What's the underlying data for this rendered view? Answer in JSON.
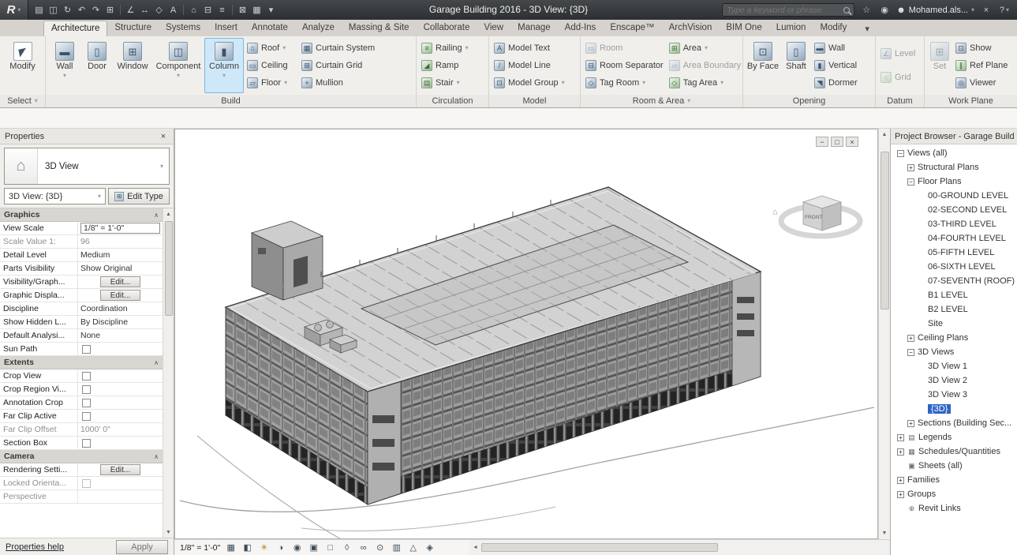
{
  "colors": {
    "titlebar-bg": "#2c2f31",
    "titlebar-top": "#45494c",
    "tabs-bg": "#d6d3ce",
    "ribbon-bg": "#f0efec",
    "column-highlight": "#cfe8f9",
    "selection": "#2d64c8"
  },
  "icons": {
    "caret": "▾",
    "open": "▤",
    "save": "◫",
    "sync": "↻",
    "undo": "↶",
    "redo": "↷",
    "print": "⊞",
    "measure": "∠",
    "dimension": "↔",
    "tag": "◇",
    "text": "A",
    "view3d": "⌂",
    "section": "⊟",
    "thin_lines": "≡",
    "close_windows": "⊠",
    "switch_windows": "▦",
    "favorites": "☆",
    "comm": "◉",
    "user": "☻",
    "exchange": "×",
    "help": "?",
    "min": "−",
    "restore": "□",
    "close": "×",
    "plus": "+",
    "minus": "−",
    "chevron": "∧",
    "scroll_left": "◄",
    "scroll_up": "▲",
    "scroll_down": "▼",
    "home": "⌂",
    "sun": "☀",
    "modify": "◤",
    "wall": "▬",
    "door": "▯",
    "window": "⊞",
    "component": "◫",
    "column": "▮",
    "roof": "⌂",
    "ceiling": "▭",
    "floor": "▱",
    "curtain_system": "▦",
    "curtain_grid": "⊞",
    "mullion": "+",
    "railing": "≡",
    "ramp": "◢",
    "stair": "▤",
    "model_text": "A",
    "model_line": "/",
    "model_group": "⊡",
    "room": "▭",
    "room_separator": "⊟",
    "tag_room": "◇",
    "area": "⊞",
    "area_boundary": "▱",
    "tag_area": "◇",
    "by_face": "⊡",
    "shaft": "▯",
    "opening_wall": "▬",
    "vertical": "▮",
    "dormer": "◥",
    "level": "∠",
    "grid": "○",
    "set": "⊞",
    "show": "⊡",
    "ref_plane": "∥",
    "viewer": "◎",
    "edit_type": "⊞",
    "detail_level": "▦",
    "visual_style": "◧",
    "shadows": "◑",
    "render": "◉",
    "crop": "▣",
    "crop_region": "□",
    "lock": "◊",
    "hide_isolate": "∞",
    "reveal": "⊙",
    "temp_props": "▥",
    "analytical": "△",
    "displacement": "◈",
    "legends": "▤",
    "schedules": "▦",
    "sheets": "▣",
    "link": "⊕"
  },
  "titlebar": {
    "app": "R",
    "title": "Garage Building 2016 - 3D View: {3D}",
    "search_placeholder": "Type a keyword or phrase",
    "user": "Mohamed.als..."
  },
  "tabs": [
    "Architecture",
    "Structure",
    "Systems",
    "Insert",
    "Annotate",
    "Analyze",
    "Massing & Site",
    "Collaborate",
    "View",
    "Manage",
    "Add-Ins",
    "Enscape™",
    "ArchVision",
    "BIM One",
    "Lumion",
    "Modify"
  ],
  "ribbon": {
    "select": {
      "label": "Select",
      "modify": "Modify"
    },
    "build": {
      "label": "Build",
      "wall": "Wall",
      "door": "Door",
      "window": "Window",
      "component": "Component",
      "column": "Column",
      "roof": "Roof",
      "ceiling": "Ceiling",
      "floor": "Floor",
      "curtain_system": "Curtain System",
      "curtain_grid": "Curtain Grid",
      "mullion": "Mullion"
    },
    "circulation": {
      "label": "Circulation",
      "railing": "Railing",
      "ramp": "Ramp",
      "stair": "Stair"
    },
    "model": {
      "label": "Model",
      "text": "Model Text",
      "line": "Model Line",
      "group": "Model Group"
    },
    "room_area": {
      "label": "Room & Area",
      "room": "Room",
      "room_separator": "Room Separator",
      "tag_room": "Tag Room",
      "area": "Area",
      "area_boundary": "Area Boundary",
      "tag_area": "Tag Area"
    },
    "opening": {
      "label": "Opening",
      "by_face": "By Face",
      "shaft": "Shaft",
      "wall": "Wall",
      "vertical": "Vertical",
      "dormer": "Dormer"
    },
    "datum": {
      "label": "Datum",
      "level": "Level",
      "grid": "Grid"
    },
    "work_plane": {
      "label": "Work Plane",
      "set": "Set",
      "show": "Show",
      "ref_plane": "Ref Plane",
      "viewer": "Viewer"
    }
  },
  "properties": {
    "header": "Properties",
    "type": "3D View",
    "view_combo": "3D View: {3D}",
    "edit_type": "Edit Type",
    "graphics": {
      "title": "Graphics",
      "rows": {
        "view_scale": {
          "label": "View Scale",
          "value": "1/8\" = 1'-0\""
        },
        "scale_value": {
          "label": "Scale Value    1:",
          "value": "96"
        },
        "detail_level": {
          "label": "Detail Level",
          "value": "Medium"
        },
        "parts_visibility": {
          "label": "Parts Visibility",
          "value": "Show Original"
        },
        "visibility": {
          "label": "Visibility/Graph...",
          "value": "Edit..."
        },
        "graphic_display": {
          "label": "Graphic Displa...",
          "value": "Edit..."
        },
        "discipline": {
          "label": "Discipline",
          "value": "Coordination"
        },
        "show_hidden": {
          "label": "Show Hidden L...",
          "value": "By Discipline"
        },
        "default_analysis": {
          "label": "Default Analysi...",
          "value": "None"
        },
        "sun_path": {
          "label": "Sun Path"
        }
      }
    },
    "extents": {
      "title": "Extents",
      "rows": {
        "crop_view": {
          "label": "Crop View"
        },
        "crop_region": {
          "label": "Crop Region Vi..."
        },
        "annotation_crop": {
          "label": "Annotation Crop"
        },
        "far_clip_active": {
          "label": "Far Clip Active"
        },
        "far_clip_offset": {
          "label": "Far Clip Offset",
          "value": "1000'  0\""
        },
        "section_box": {
          "label": "Section Box"
        }
      }
    },
    "camera": {
      "title": "Camera",
      "rows": {
        "rendering": {
          "label": "Rendering Setti...",
          "value": "Edit..."
        },
        "locked_orientation": {
          "label": "Locked Orienta..."
        },
        "perspective": {
          "label": "Perspective"
        }
      }
    },
    "help": "Properties help",
    "apply": "Apply"
  },
  "browser": {
    "title": "Project Browser - Garage Build",
    "views_all": "Views (all)",
    "structural_plans": "Structural Plans",
    "floor_plans": "Floor Plans",
    "floors": [
      "00-GROUND LEVEL",
      "02-SECOND LEVEL",
      "03-THIRD LEVEL",
      "04-FOURTH LEVEL",
      "05-FIFTH LEVEL",
      "06-SIXTH LEVEL",
      "07-SEVENTH (ROOF)",
      "B1 LEVEL",
      "B2 LEVEL",
      "Site"
    ],
    "ceiling_plans": "Ceiling Plans",
    "views_3d": "3D Views",
    "views_3d_items": [
      "3D View 1",
      "3D View 2",
      "3D View 3",
      "{3D}"
    ],
    "sections": "Sections (Building Sec...",
    "legends": "Legends",
    "schedules": "Schedules/Quantities",
    "sheets": "Sheets (all)",
    "families": "Families",
    "groups": "Groups",
    "revit_links": "Revit Links"
  },
  "view": {
    "scale": "1/8\" = 1'-0\"",
    "viewcube_front": "FRONT"
  }
}
